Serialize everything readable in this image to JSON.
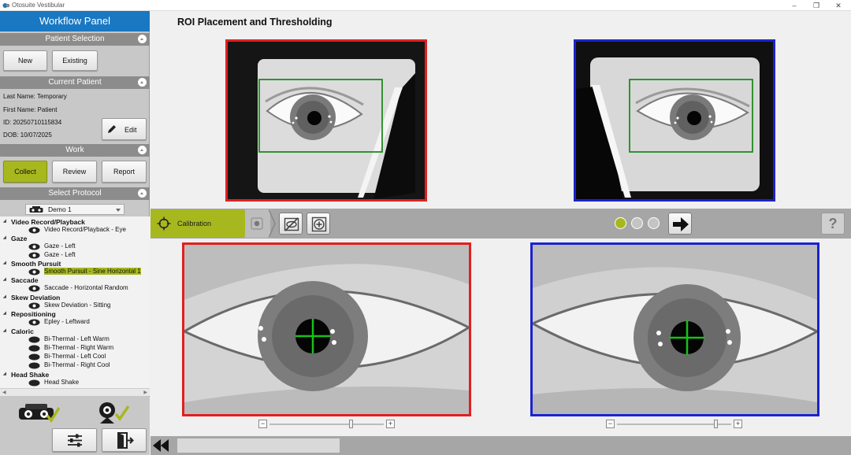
{
  "window": {
    "title": "Otosuite Vestibular"
  },
  "workflow": {
    "title": "Workflow Panel",
    "patient_selection": {
      "header": "Patient Selection",
      "new_label": "New",
      "existing_label": "Existing"
    },
    "current_patient": {
      "header": "Current Patient",
      "last_name": "Last Name:  Temporary",
      "first_name": "First Name:  Patient",
      "id": "ID:  20250710115834",
      "dob": "DOB:  10/07/2025",
      "edit_label": "Edit"
    },
    "work": {
      "header": "Work",
      "collect_label": "Collect",
      "review_label": "Review",
      "report_label": "Report"
    },
    "protocol": {
      "header": "Select Protocol",
      "selected": "Demo 1",
      "groups": [
        {
          "label": "Video Record/Playback",
          "items": [
            "Video Record/Playback - Eye"
          ]
        },
        {
          "label": "Gaze",
          "items": [
            "Gaze - Left",
            "Gaze - Left"
          ]
        },
        {
          "label": "Smooth Pursuit",
          "items": [
            "Smooth Pursuit - Sine Horizontal 1"
          ]
        },
        {
          "label": "Saccade",
          "items": [
            "Saccade - Horizontal Random"
          ]
        },
        {
          "label": "Skew Deviation",
          "items": [
            "Skew Deviation - Sitting"
          ]
        },
        {
          "label": "Repositioning",
          "items": [
            "Epley - Leftward"
          ]
        },
        {
          "label": "Caloric",
          "items": [
            "Bi-Thermal - Left Warm",
            "Bi-Thermal - Right Warm",
            "Bi-Thermal - Left Cool",
            "Bi-Thermal - Right Cool"
          ]
        },
        {
          "label": "Head Shake",
          "items": [
            "Head Shake"
          ]
        }
      ]
    }
  },
  "main": {
    "title": "ROI Placement and Thresholding",
    "toolbar": {
      "step_label": "Calibration",
      "steps_total": 3,
      "steps_active": 1,
      "help_label": "?"
    }
  },
  "colors": {
    "accent": "#a7b81f",
    "brand": "#1a78c2",
    "left_eye": "#e02020",
    "right_eye": "#1a22d0",
    "roi": "#1f8a1f",
    "crosshair": "#16c216"
  },
  "icons": [
    "app-icon",
    "collapse-icon",
    "edit-pencil-icon",
    "goggles-icon",
    "eye-icon",
    "crosshair-target-icon",
    "record-icon",
    "hide-roi-icon",
    "add-roi-icon",
    "arrow-right-icon",
    "camera-icon",
    "check-icon",
    "settings-sliders-icon",
    "exit-door-icon",
    "rewind-icon"
  ]
}
